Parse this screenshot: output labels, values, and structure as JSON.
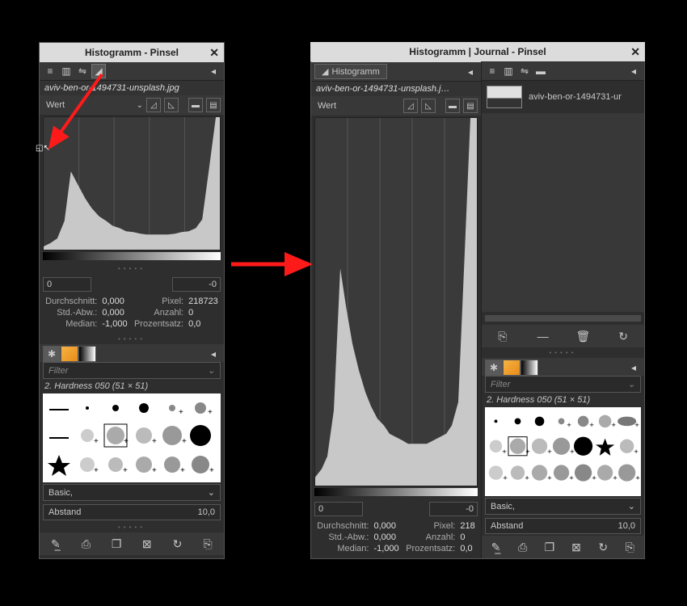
{
  "left_window": {
    "title": "Histogramm - Pinsel",
    "filename": "aviv-ben-or-1494731-unsplash.jpg",
    "channel": "Wert",
    "range_min": "0",
    "range_max": "-0",
    "stats": {
      "durchschnitt_label": "Durchschnitt:",
      "durchschnitt": "0,000",
      "stdabw_label": "Std.-Abw.:",
      "stdabw": "0,000",
      "median_label": "Median:",
      "median": "-1,000",
      "pixel_label": "Pixel:",
      "pixel": "218723",
      "anzahl_label": "Anzahl:",
      "anzahl": "0",
      "prozent_label": "Prozentsatz:",
      "prozent": "0,0"
    },
    "filter_placeholder": "Filter",
    "brush_name": "2. Hardness 050 (51 × 51)",
    "basic_label": "Basic,",
    "abstand_label": "Abstand",
    "abstand_value": "10,0"
  },
  "right_window": {
    "title": "Histogramm | Journal - Pinsel",
    "tab_label": "Histogramm",
    "filename": "aviv-ben-or-1494731-unsplash.j…",
    "journal_filename": "aviv-ben-or-1494731-ur",
    "channel": "Wert",
    "range_min": "0",
    "range_max": "-0",
    "stats": {
      "durchschnitt_label": "Durchschnitt:",
      "durchschnitt": "0,000",
      "stdabw_label": "Std.-Abw.:",
      "stdabw": "0,000",
      "median_label": "Median:",
      "median": "-1,000",
      "pixel_label": "Pixel:",
      "pixel": "218",
      "anzahl_label": "Anzahl:",
      "anzahl": "0",
      "prozent_label": "Prozentsatz:",
      "prozent": "0,0"
    },
    "filter_placeholder": "Filter",
    "brush_name": "2. Hardness 050 (51 × 51)",
    "basic_label": "Basic,",
    "abstand_label": "Abstand",
    "abstand_value": "10,0"
  },
  "chart_data": {
    "type": "area",
    "title": "Histogramm",
    "xlabel": "",
    "ylabel": "",
    "xlim": [
      0,
      255
    ],
    "ylim": [
      0,
      100
    ],
    "x": [
      0,
      10,
      20,
      30,
      40,
      50,
      60,
      70,
      80,
      90,
      100,
      110,
      120,
      130,
      140,
      150,
      160,
      170,
      180,
      190,
      200,
      210,
      220,
      230,
      240,
      250,
      255
    ],
    "values": [
      3,
      5,
      8,
      20,
      55,
      45,
      35,
      28,
      22,
      18,
      15,
      13,
      11,
      10,
      9,
      8,
      8,
      8,
      8,
      9,
      10,
      11,
      13,
      20,
      60,
      100,
      100
    ]
  }
}
